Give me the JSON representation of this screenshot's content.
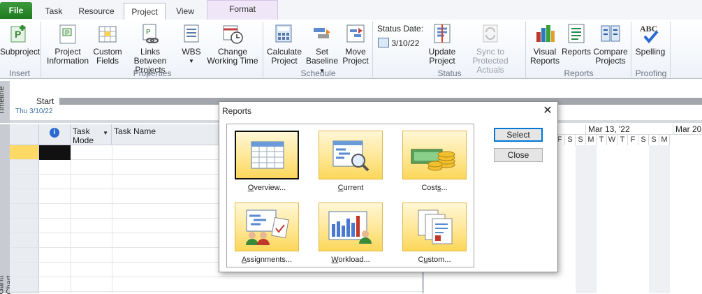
{
  "ribbon_tabs": [
    {
      "label": "File"
    },
    {
      "label": "Task"
    },
    {
      "label": "Resource"
    },
    {
      "label": "Project"
    },
    {
      "label": "View"
    },
    {
      "label": "Format"
    }
  ],
  "ribbon": {
    "subproject": "Subproject",
    "project_information": [
      "Project",
      "Information"
    ],
    "custom_fields": [
      "Custom",
      "Fields"
    ],
    "links_between_projects": [
      "Links Between",
      "Projects"
    ],
    "wbs": "WBS",
    "change_working_time": [
      "Change",
      "Working Time"
    ],
    "calculate_project": [
      "Calculate",
      "Project"
    ],
    "set_baseline": [
      "Set",
      "Baseline"
    ],
    "move_project": [
      "Move",
      "Project"
    ],
    "status_date_label": "Status Date:",
    "status_date_value": "3/10/22",
    "update_project": [
      "Update",
      "Project"
    ],
    "sync_protected": [
      "Sync to",
      "Protected Actuals"
    ],
    "visual_reports": [
      "Visual",
      "Reports"
    ],
    "reports": "Reports",
    "compare_projects": [
      "Compare",
      "Projects"
    ],
    "spelling": "Spelling",
    "groups": {
      "insert": "Insert",
      "properties": "Properties",
      "schedule": "Schedule",
      "status": "Status",
      "reports": "Reports",
      "proofing": "Proofing"
    }
  },
  "timeline": {
    "side_label": "Timeline",
    "start_label": "Start",
    "start_date": "Thu 3/10/22"
  },
  "grid": {
    "side_label": "Gantt Chart",
    "col_task_mode": [
      "Task",
      "Mode"
    ],
    "col_task_name": "Task Name"
  },
  "gantt": {
    "week1": "Mar 13, '22",
    "week2": "Mar 20",
    "days": [
      "F",
      "S",
      "S",
      "M",
      "T",
      "W",
      "T",
      "F",
      "S",
      "S",
      "M"
    ]
  },
  "dialog": {
    "title": "Reports",
    "reports": [
      {
        "label": "Overview...",
        "underline": "O",
        "rest": "verview..."
      },
      {
        "label": "Current",
        "underline": "C",
        "rest": "urrent"
      },
      {
        "label": "Costs...",
        "underline": "s",
        "pre": "Cost",
        "rest": "..."
      },
      {
        "label": "Assignments...",
        "underline": "A",
        "rest": "ssignments..."
      },
      {
        "label": "Workload...",
        "underline": "W",
        "rest": "orkload..."
      },
      {
        "label": "Custom...",
        "underline": "u",
        "pre": "C",
        "rest": "stom..."
      }
    ],
    "select_label": "Select",
    "close_label": "Close"
  },
  "colors": {
    "file_tab": "#2a8a2a",
    "accent": "#0078d7",
    "card_bg": "#ffe795"
  }
}
